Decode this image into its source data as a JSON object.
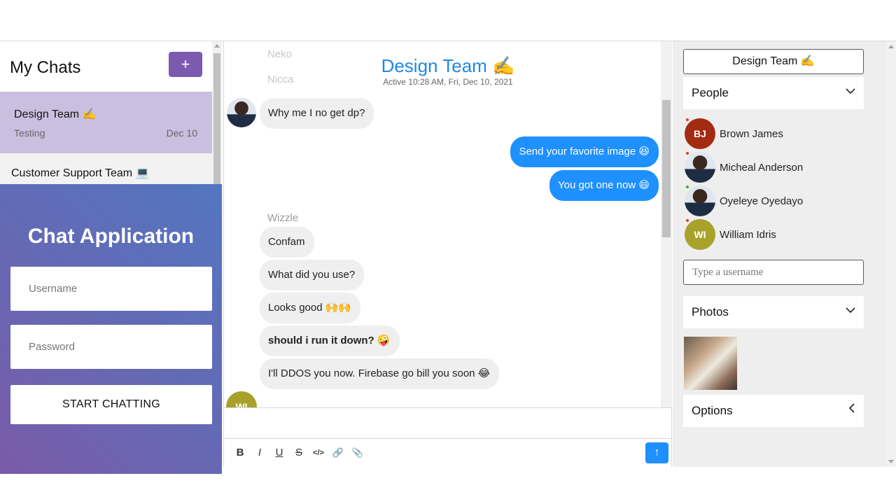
{
  "sidebar": {
    "title": "My Chats",
    "new_chat_label": "+",
    "chats": [
      {
        "name": "Design Team ✍️",
        "preview": "Testing",
        "date": "Dec 10"
      },
      {
        "name": "Customer Support Team 💻"
      }
    ]
  },
  "login": {
    "title": "Chat Application",
    "username_placeholder": "Username",
    "password_placeholder": "Password",
    "button_label": "START CHATTING"
  },
  "chat": {
    "title": "Design Team ✍️",
    "subtitle": "Active 10:28 AM, Fri, Dec 10, 2021",
    "faded_messages": [
      "Neko",
      "Nicca"
    ],
    "messages": [
      {
        "text": "Why me I no get dp?",
        "from": "other"
      },
      {
        "text": "Send your favorite image 😆",
        "from": "me"
      },
      {
        "text": "You got one now 😄",
        "from": "me"
      },
      {
        "text": "Confam",
        "from": "other"
      },
      {
        "text": "What did you use?",
        "from": "other"
      },
      {
        "text": "Looks good 🙌🙌",
        "from": "other"
      },
      {
        "text": "should i run it down? 🤪",
        "from": "other"
      },
      {
        "text": "I'll DDOS you now. Firebase go bill you soon 😂",
        "from": "other"
      }
    ],
    "sender_name": "Wizzle",
    "partial_avatar": "WI"
  },
  "toolbar": {
    "bold": "B",
    "italic": "I",
    "underline": "U",
    "strike": "S",
    "code": "</>",
    "link": "🔗",
    "attach": "📎",
    "send": "↑"
  },
  "details": {
    "title_button": "Design Team ✍️",
    "people_label": "People",
    "people": [
      {
        "initials": "BJ",
        "name": "Brown James",
        "color": "#a32b12",
        "status": "#e53935"
      },
      {
        "initials": "",
        "name": "Micheal Anderson",
        "color": "#2e3a4e",
        "status": "#e53935"
      },
      {
        "initials": "",
        "name": "Oyeleye Oyedayo",
        "color": "#2e3a4e",
        "status": "#43a047"
      },
      {
        "initials": "WI",
        "name": "William Idris",
        "color": "#a8a22a",
        "status": "#e53935"
      }
    ],
    "user_search_placeholder": "Type a username",
    "photos_label": "Photos",
    "options_label": "Options"
  },
  "colors": {
    "accent": "#1e90ff",
    "purple": "#7b5ab0"
  }
}
